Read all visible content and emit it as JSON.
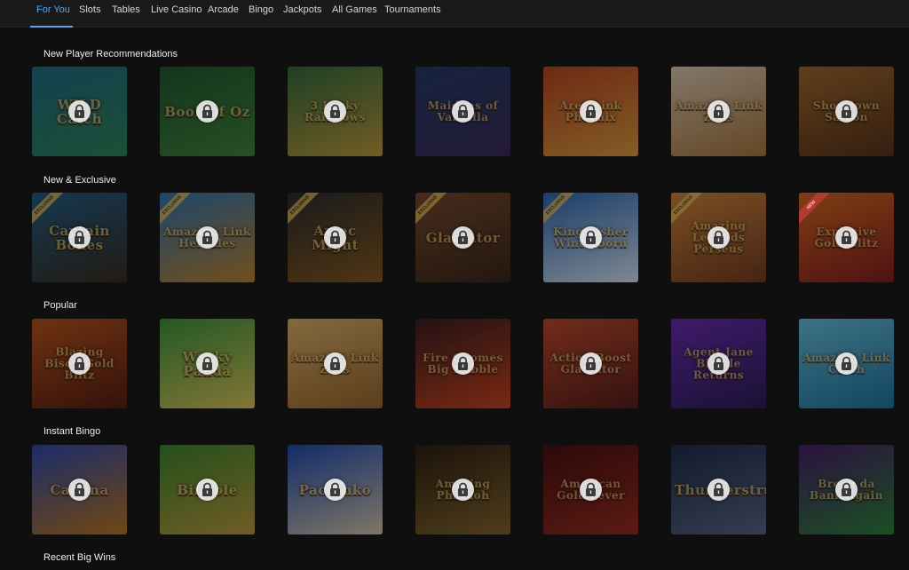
{
  "nav": {
    "items": [
      {
        "label": "For You",
        "active": true
      },
      {
        "label": "Slots",
        "active": false
      },
      {
        "label": "Tables",
        "active": false
      },
      {
        "label": "Live Casino",
        "active": false
      },
      {
        "label": "Arcade",
        "active": false
      },
      {
        "label": "Bingo",
        "active": false
      },
      {
        "label": "Jackpots",
        "active": false
      },
      {
        "label": "All Games",
        "active": false
      },
      {
        "label": "Tournaments",
        "active": false
      }
    ],
    "active_color": "#4aa9ff"
  },
  "sections": [
    {
      "title": "New Player Recommendations",
      "games": [
        {
          "title": "WILD Catch",
          "c1": "#1f6f8a",
          "c2": "#2a8c5a",
          "locked": true
        },
        {
          "title": "Book of Oz",
          "c1": "#1e5a2b",
          "c2": "#3f8a3a",
          "locked": true
        },
        {
          "title": "3 Lucky Rainbows",
          "c1": "#2f6f3a",
          "c2": "#c9a13a",
          "locked": true
        },
        {
          "title": "Maidens of Valhalla",
          "c1": "#233a6a",
          "c2": "#3a2a5a",
          "locked": true
        },
        {
          "title": "Area Link Phoenix",
          "c1": "#c2451c",
          "c2": "#e8a23a",
          "locked": true
        },
        {
          "title": "Amazing Link Zeus",
          "c1": "#e6d2b8",
          "c2": "#b07a3a",
          "locked": true
        },
        {
          "title": "Showdown Saloon",
          "c1": "#a86a2a",
          "c2": "#5a3214",
          "locked": true
        }
      ]
    },
    {
      "title": "New & Exclusive",
      "games": [
        {
          "title": "Captain Bones",
          "c1": "#1f5f8a",
          "c2": "#3a2a1a",
          "badge": "EXCLUSIVE",
          "locked": true
        },
        {
          "title": "Amazing Link Hercules",
          "c1": "#2f7ab8",
          "c2": "#c8892a",
          "badge": "EXCLUSIVE",
          "locked": true
        },
        {
          "title": "Aztec Might",
          "c1": "#2a2a2a",
          "c2": "#8a5a1a",
          "badge": "EXCLUSIVE",
          "locked": true
        },
        {
          "title": "Gladiator",
          "c1": "#7a4a2a",
          "c2": "#3a2414",
          "badge": "EXCLUSIVE",
          "locked": true
        },
        {
          "title": "King Fisher Winterborn",
          "c1": "#2a6ab8",
          "c2": "#e0f0ff",
          "badge": "EXCLUSIVE",
          "locked": true
        },
        {
          "title": "Amazing Legends Perseus",
          "c1": "#d88a3a",
          "c2": "#7a3a1a",
          "badge": "EXCLUSIVE",
          "locked": true
        },
        {
          "title": "Explosive Gold Blitz",
          "c1": "#e06a1a",
          "c2": "#8a1a1a",
          "badge": "NEW",
          "badge_red": true,
          "locked": true
        }
      ]
    },
    {
      "title": "Popular",
      "games": [
        {
          "title": "Blazing Bison Gold Blitz",
          "c1": "#c2551a",
          "c2": "#5a1a0a",
          "locked": true
        },
        {
          "title": "Wacky Panda",
          "c1": "#3a9a3a",
          "c2": "#e8d05a",
          "locked": true
        },
        {
          "title": "Amazing Link Zeus",
          "c1": "#e8b86a",
          "c2": "#a06a2a",
          "locked": true
        },
        {
          "title": "Fire Gnomes Big Bubble",
          "c1": "#3a1a1a",
          "c2": "#d8441a",
          "locked": true
        },
        {
          "title": "Action Boost Gladiator",
          "c1": "#c84a2a",
          "c2": "#5a1a14",
          "locked": true
        },
        {
          "title": "Agent Jane Blonde Returns",
          "c1": "#6a2ab8",
          "c2": "#2a1a5a",
          "locked": true
        },
        {
          "title": "Amazing Link Catch",
          "c1": "#6ac8e8",
          "c2": "#1a7aa8",
          "locked": true
        }
      ]
    },
    {
      "title": "Instant Bingo",
      "games": [
        {
          "title": "Catrina",
          "c1": "#2a4ab8",
          "c2": "#c87a1a",
          "locked": true
        },
        {
          "title": "Bingole",
          "c1": "#3a8a2a",
          "c2": "#c8a23a",
          "locked": true
        },
        {
          "title": "Pachinko",
          "c1": "#1a4ab8",
          "c2": "#e0d0b0",
          "locked": true
        },
        {
          "title": "Amazing Pharaoh",
          "c1": "#2a1a0a",
          "c2": "#8a6a2a",
          "locked": true
        },
        {
          "title": "American Gold Fever",
          "c1": "#4a0a0a",
          "c2": "#a02a1a",
          "locked": true
        },
        {
          "title": "Thunderstruck",
          "c1": "#1a2a4a",
          "c2": "#5a6a8a",
          "locked": true
        },
        {
          "title": "Break da Bank Again",
          "c1": "#4a1a6a",
          "c2": "#2a8a3a",
          "locked": true
        }
      ]
    },
    {
      "title": "Recent Big Wins",
      "games": []
    }
  ]
}
